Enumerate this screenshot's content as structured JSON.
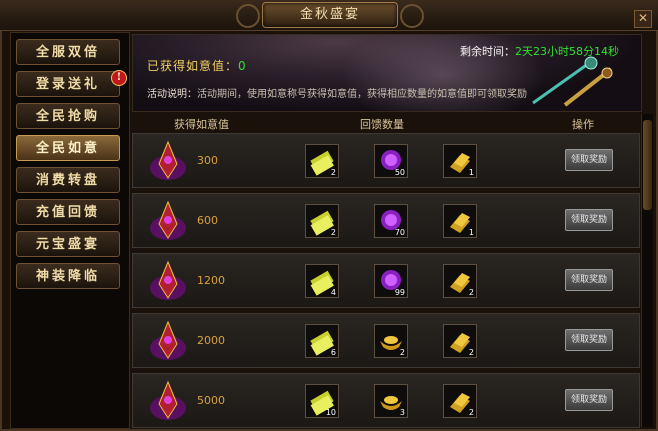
{
  "window": {
    "title": "金秋盛宴",
    "close_glyph": "✕"
  },
  "sidebar": {
    "items": [
      {
        "label": "全服双倍",
        "active": false,
        "badge": ""
      },
      {
        "label": "登录送礼",
        "active": false,
        "badge": "!"
      },
      {
        "label": "全民抢购",
        "active": false,
        "badge": ""
      },
      {
        "label": "全民如意",
        "active": true,
        "badge": ""
      },
      {
        "label": "消费转盘",
        "active": false,
        "badge": ""
      },
      {
        "label": "充值回馈",
        "active": false,
        "badge": ""
      },
      {
        "label": "元宝盛宴",
        "active": false,
        "badge": ""
      },
      {
        "label": "神装降临",
        "active": false,
        "badge": ""
      }
    ]
  },
  "banner": {
    "gained_label": "已获得如意值：",
    "gained_value": "0",
    "remain_label": "剩余时间：",
    "remain_value": "2天23小时58分14秒",
    "desc_label": "活动说明：",
    "desc_body": "活动期间，使用如意称号获得如意值，获得相应数量的如意值即可领取奖励"
  },
  "headers": {
    "col1": "获得如意值",
    "col2": "回馈数量",
    "col3": "操作"
  },
  "rows": [
    {
      "value": "300",
      "rewards": [
        {
          "icon": "scroll-icon",
          "count": "2"
        },
        {
          "icon": "purple-orb-icon",
          "count": "50"
        },
        {
          "icon": "gold-bars-icon",
          "count": "1"
        }
      ],
      "button": "领取奖励"
    },
    {
      "value": "600",
      "rewards": [
        {
          "icon": "scroll-icon",
          "count": "2"
        },
        {
          "icon": "purple-orb-icon",
          "count": "70"
        },
        {
          "icon": "gold-bars-icon",
          "count": "1"
        }
      ],
      "button": "领取奖励"
    },
    {
      "value": "1200",
      "rewards": [
        {
          "icon": "scroll-icon",
          "count": "4"
        },
        {
          "icon": "purple-orb-icon",
          "count": "99"
        },
        {
          "icon": "gold-bars-icon",
          "count": "2"
        }
      ],
      "button": "领取奖励"
    },
    {
      "value": "2000",
      "rewards": [
        {
          "icon": "scroll-icon",
          "count": "6"
        },
        {
          "icon": "gold-ingot-icon",
          "count": "2"
        },
        {
          "icon": "gold-bars-icon",
          "count": "2"
        }
      ],
      "button": "领取奖励"
    },
    {
      "value": "5000",
      "rewards": [
        {
          "icon": "scroll-icon",
          "count": "10"
        },
        {
          "icon": "gold-ingot-icon",
          "count": "3"
        },
        {
          "icon": "gold-bars-icon",
          "count": "2"
        }
      ],
      "button": "领取奖励"
    }
  ],
  "colors": {
    "accent": "#f0d060",
    "value_green": "#30e030",
    "gold_text": "#d9a040"
  }
}
